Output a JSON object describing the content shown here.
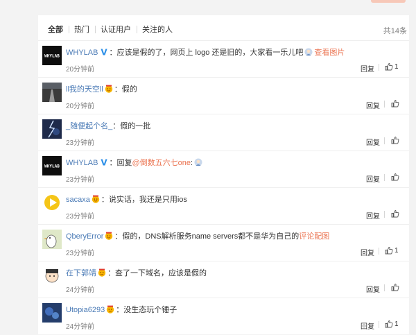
{
  "tabs": [
    {
      "label": "全部",
      "active": true
    },
    {
      "label": "热门",
      "active": false
    },
    {
      "label": "认证用户",
      "active": false
    },
    {
      "label": "关注的人",
      "active": false
    }
  ],
  "total_count": "共14条",
  "reply_label": "回复",
  "comments": [
    {
      "user": "WHYLAB",
      "verified": true,
      "emoji": false,
      "text": "应该是假的了，网页上 logo 还是旧的，大家看一乐儿吧",
      "avatar_emoji": true,
      "link": "查看图片",
      "time": "20分钟前",
      "likes": "1",
      "avatar_icon": "whylab-logo"
    },
    {
      "user": "ll我的天空ll",
      "verified": false,
      "emoji": true,
      "text": "假的",
      "time": "20分钟前",
      "likes": "",
      "avatar_icon": "road-photo"
    },
    {
      "user": "_随便起个名_",
      "verified": false,
      "emoji": false,
      "text": "假的一批",
      "time": "23分钟前",
      "likes": "",
      "avatar_icon": "lightning-photo"
    },
    {
      "user": "WHYLAB",
      "verified": true,
      "emoji": false,
      "reply_prefix": "回复",
      "mention": "@倒数五六七one",
      "text": "",
      "avatar_emoji": true,
      "time": "23分钟前",
      "likes": "",
      "avatar_icon": "whylab-logo"
    },
    {
      "user": "sacaxa",
      "verified": false,
      "emoji": true,
      "text": "说实话，我还是只用ios",
      "time": "23分钟前",
      "likes": "",
      "avatar_icon": "yellow-play-logo"
    },
    {
      "user": "QberyError",
      "verified": false,
      "emoji": true,
      "text": "假的，DNS解析服务name servers都不是华为自己的",
      "link": "评论配图",
      "time": "23分钟前",
      "likes": "1",
      "avatar_icon": "bird-drawing"
    },
    {
      "user": "在下郭靖",
      "verified": false,
      "emoji": true,
      "text": "查了一下域名，应该是假的",
      "time": "24分钟前",
      "likes": "",
      "avatar_icon": "cartoon-face"
    },
    {
      "user": "Utopia6293",
      "verified": false,
      "emoji": true,
      "text": "没生态玩个锤子",
      "time": "24分钟前",
      "likes": "1",
      "avatar_icon": "blue-photo"
    }
  ]
}
